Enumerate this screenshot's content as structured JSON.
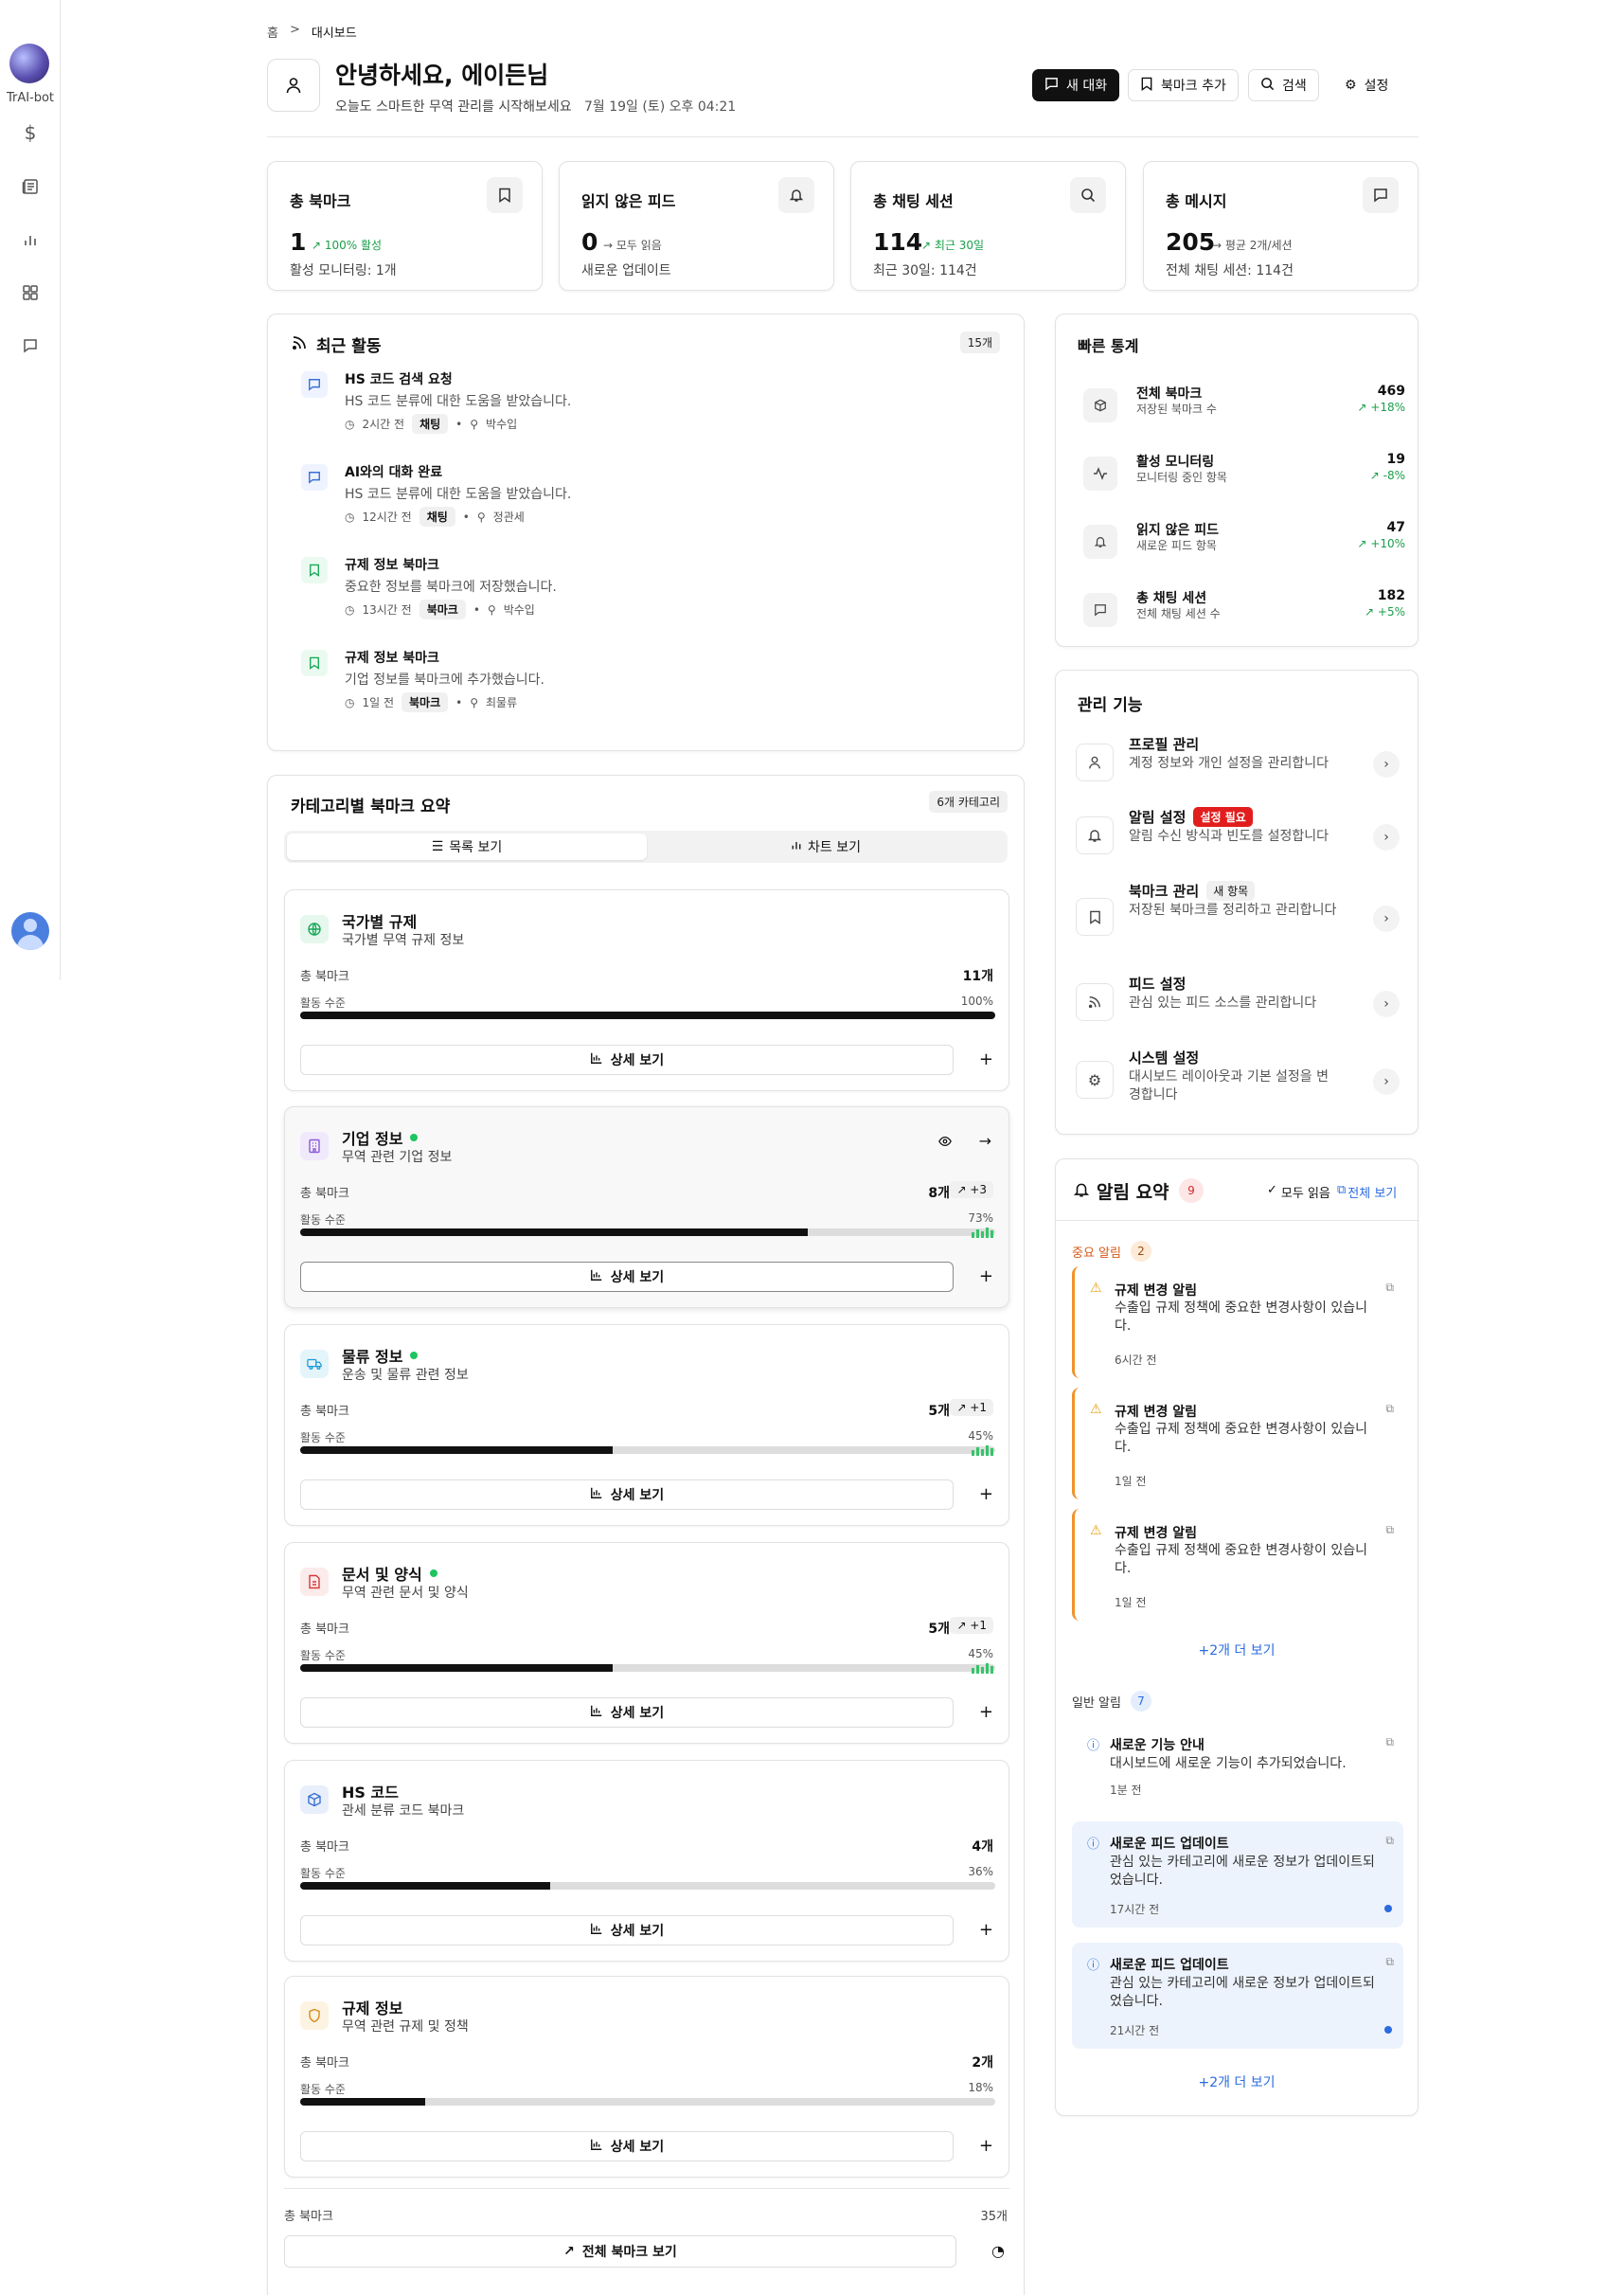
{
  "sidebar": {
    "brand": "TrAI-bot"
  },
  "breadcrumb": {
    "home": "홈",
    "sep": ">",
    "current": "대시보드"
  },
  "header": {
    "title": "안녕하세요, 에이든님",
    "subtitle": "오늘도 스마트한 무역 관리를 시작해보세요",
    "datetime": "7월 19일 (토) 오후 04:21",
    "buttons": {
      "new_chat": "새 대화",
      "add_bookmark": "북마크 추가",
      "search": "검색",
      "settings": "설정"
    }
  },
  "stats": [
    {
      "title": "총 북마크",
      "value": "1",
      "trend": "↗ 100% 활성",
      "sub": "활성 모니터링: 1개",
      "icon": "bookmark-icon"
    },
    {
      "title": "읽지 않은 피드",
      "value": "0",
      "trend": "→ 모두 읽음",
      "sub": "새로운 업데이트",
      "icon": "bell-icon"
    },
    {
      "title": "총 채팅 세션",
      "value": "114",
      "trend": "↗ 최근 30일",
      "sub": "최근 30일: 114건",
      "icon": "search-icon"
    },
    {
      "title": "총 메시지",
      "value": "205",
      "trend": "→ 평균 2개/세션",
      "sub": "전체 채팅 세션: 114건",
      "icon": "message-icon"
    }
  ],
  "recent": {
    "title": "최근 활동",
    "count": "15개",
    "items": [
      {
        "title": "HS 코드 검색 요청",
        "desc": "HS 코드 분류에 대한 도움을 받았습니다.",
        "time": "2시간 전",
        "tag": "채팅",
        "user": "박수입",
        "icon": "chat-icon"
      },
      {
        "title": "AI와의 대화 완료",
        "desc": "HS 코드 분류에 대한 도움을 받았습니다.",
        "time": "12시간 전",
        "tag": "채팅",
        "user": "정관세",
        "icon": "chat-icon"
      },
      {
        "title": "규제 정보 북마크",
        "desc": "중요한 정보를 북마크에 저장했습니다.",
        "time": "13시간 전",
        "tag": "북마크",
        "user": "박수입",
        "icon": "bookmark-icon"
      },
      {
        "title": "규제 정보 북마크",
        "desc": "기업 정보를 북마크에 추가했습니다.",
        "time": "1일 전",
        "tag": "북마크",
        "user": "최물류",
        "icon": "bookmark-icon"
      }
    ]
  },
  "categories": {
    "title": "카테고리별 북마크 요약",
    "count": "6개 카테고리",
    "list_view": "목록 보기",
    "chart_view": "차트 보기",
    "total_label": "총 북마크",
    "activity_label": "활동 수준",
    "detail_label": "상세 보기",
    "items": [
      {
        "name": "국가별 규제",
        "desc": "국가별 무역 규제 정보",
        "count": "11개",
        "change": "",
        "pct": "100%",
        "level": 1.0,
        "color": "#1aa858",
        "bg": "#e6f7ee",
        "icon": "globe-icon",
        "active": false
      },
      {
        "name": "기업 정보",
        "desc": "무역 관련 기업 정보",
        "count": "8개",
        "change": "↗ +3",
        "pct": "73%",
        "level": 0.73,
        "color": "#8a5cd6",
        "bg": "#f0e9fb",
        "icon": "building-icon",
        "active": true
      },
      {
        "name": "물류 정보",
        "desc": "운송 및 물류 관련 정보",
        "count": "5개",
        "change": "↗ +1",
        "pct": "45%",
        "level": 0.45,
        "color": "#1a9ad6",
        "bg": "#e4f4fb",
        "icon": "truck-icon",
        "active": true
      },
      {
        "name": "문서 및 양식",
        "desc": "무역 관련 문서 및 양식",
        "count": "5개",
        "change": "↗ +1",
        "pct": "45%",
        "level": 0.45,
        "color": "#d63a3a",
        "bg": "#fcebeb",
        "icon": "document-icon",
        "active": true
      },
      {
        "name": "HS 코드",
        "desc": "관세 분류 코드 북마크",
        "count": "4개",
        "change": "",
        "pct": "36%",
        "level": 0.36,
        "color": "#3a6fd6",
        "bg": "#e8effb",
        "icon": "box-icon",
        "active": false
      },
      {
        "name": "규제 정보",
        "desc": "무역 관련 규제 및 정책",
        "count": "2개",
        "change": "",
        "pct": "18%",
        "level": 0.18,
        "color": "#d68a1a",
        "bg": "#fdf3e2",
        "icon": "shield-icon",
        "active": false
      }
    ],
    "footer_label": "총 북마크",
    "footer_count": "35개",
    "view_all": "전체 북마크 보기"
  },
  "quick": {
    "title": "빠른 통계",
    "items": [
      {
        "title": "전체 북마크",
        "desc": "저장된 북마크 수",
        "value": "469",
        "change": "↗ +18%",
        "icon": "cube-icon"
      },
      {
        "title": "활성 모니터링",
        "desc": "모니터링 중인 항목",
        "value": "19",
        "change": "↗ -8%",
        "icon": "pulse-icon"
      },
      {
        "title": "읽지 않은 피드",
        "desc": "새로운 피드 항목",
        "value": "47",
        "change": "↗ +10%",
        "icon": "bell-icon"
      },
      {
        "title": "총 채팅 세션",
        "desc": "전체 채팅 세션 수",
        "value": "182",
        "change": "↗ +5%",
        "icon": "message-icon"
      }
    ]
  },
  "manage": {
    "title": "관리 기능",
    "items": [
      {
        "title": "프로필 관리",
        "desc": "계정 정보와 개인 설정을 관리합니다",
        "badge": "",
        "icon": "user-icon"
      },
      {
        "title": "알림 설정",
        "desc": "알림 수신 방식과 빈도를 설정합니다",
        "badge": "설정 필요",
        "icon": "bell-icon"
      },
      {
        "title": "북마크 관리",
        "desc": "저장된 북마크를 정리하고 관리합니다",
        "badge": "새 항목",
        "icon": "bookmark-icon"
      },
      {
        "title": "피드 설정",
        "desc": "관심 있는 피드 소스를 관리합니다",
        "badge": "",
        "icon": "rss-icon"
      },
      {
        "title": "시스템 설정",
        "desc": "대시보드 레이아웃과 기본 설정을 변경합니다",
        "badge": "",
        "icon": "gear-icon"
      }
    ]
  },
  "notifications": {
    "title": "알림 요약",
    "count": "9",
    "mark_all": "모두 읽음",
    "view_all": "전체 보기",
    "critical_label": "중요 알림",
    "critical_count": "2",
    "critical": [
      {
        "title": "규제 변경 알림",
        "desc": "수출입 규제 정책에 중요한 변경사항이 있습니다.",
        "time": "6시간 전"
      },
      {
        "title": "규제 변경 알림",
        "desc": "수출입 규제 정책에 중요한 변경사항이 있습니다.",
        "time": "1일 전"
      },
      {
        "title": "규제 변경 알림",
        "desc": "수출입 규제 정책에 중요한 변경사항이 있습니다.",
        "time": "1일 전"
      }
    ],
    "critical_more": "+2개 더 보기",
    "general_label": "일반 알림",
    "general_count": "7",
    "general": [
      {
        "title": "새로운 기능 안내",
        "desc": "대시보드에 새로운 기능이 추가되었습니다.",
        "time": "1분 전"
      },
      {
        "title": "새로운 피드 업데이트",
        "desc": "관심 있는 카테고리에 새로운 정보가 업데이트되었습니다.",
        "time": "17시간 전"
      },
      {
        "title": "새로운 피드 업데이트",
        "desc": "관심 있는 카테고리에 새로운 정보가 업데이트되었습니다.",
        "time": "21시간 전"
      }
    ],
    "general_more": "+2개 더 보기"
  }
}
